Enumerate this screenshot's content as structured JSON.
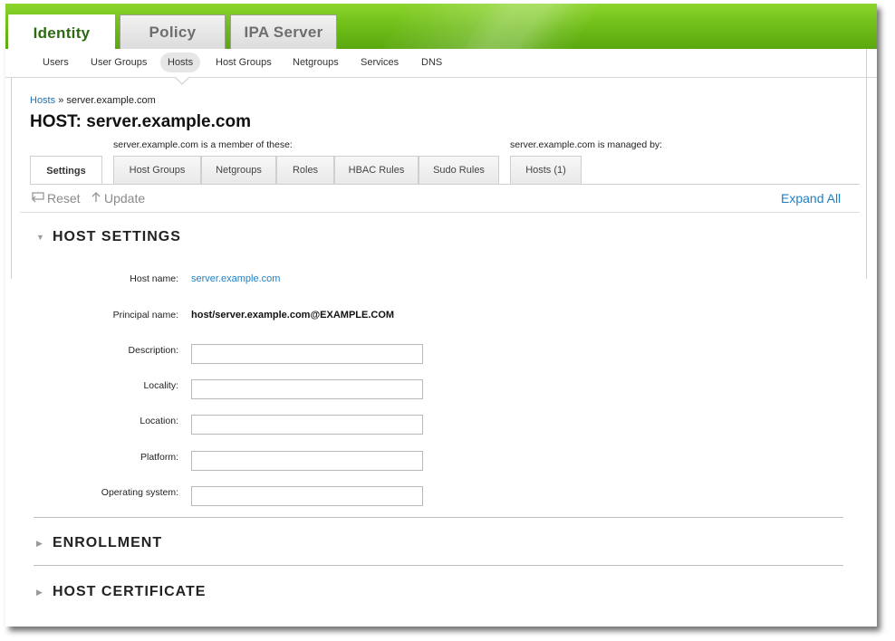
{
  "main_tabs": [
    {
      "label": "Identity",
      "active": true
    },
    {
      "label": "Policy",
      "active": false
    },
    {
      "label": "IPA Server",
      "active": false
    }
  ],
  "sub_nav": [
    {
      "label": "Users",
      "active": false
    },
    {
      "label": "User Groups",
      "active": false
    },
    {
      "label": "Hosts",
      "active": true
    },
    {
      "label": "Host Groups",
      "active": false
    },
    {
      "label": "Netgroups",
      "active": false
    },
    {
      "label": "Services",
      "active": false
    },
    {
      "label": "DNS",
      "active": false
    }
  ],
  "breadcrumb": {
    "link": "Hosts",
    "separator": "»",
    "current": "server.example.com"
  },
  "page_title": "HOST: server.example.com",
  "facets": {
    "member_caption": "server.example.com is a member of these:",
    "managed_caption": "server.example.com is managed by:",
    "tabs": [
      {
        "label": "Settings",
        "active": true
      },
      {
        "label": "Host Groups",
        "active": false
      },
      {
        "label": "Netgroups",
        "active": false
      },
      {
        "label": "Roles",
        "active": false
      },
      {
        "label": "HBAC Rules",
        "active": false
      },
      {
        "label": "Sudo Rules",
        "active": false
      },
      {
        "label": "Hosts (1)",
        "active": false
      }
    ]
  },
  "actions": {
    "reset": "Reset",
    "update": "Update",
    "expand_all": "Expand All"
  },
  "sections": {
    "host_settings": "HOST SETTINGS",
    "enrollment": "ENROLLMENT",
    "host_certificate": "HOST CERTIFICATE"
  },
  "fields": {
    "host_name": {
      "label": "Host name:",
      "value": "server.example.com"
    },
    "principal_name": {
      "label": "Principal name:",
      "value": "host/server.example.com@EXAMPLE.COM"
    },
    "description": {
      "label": "Description:",
      "value": ""
    },
    "locality": {
      "label": "Locality:",
      "value": ""
    },
    "location": {
      "label": "Location:",
      "value": ""
    },
    "platform": {
      "label": "Platform:",
      "value": ""
    },
    "operating_system": {
      "label": "Operating system:",
      "value": ""
    }
  },
  "icons": {
    "reset": "reset-icon",
    "update": "update-icon",
    "expanded": "triangle-down-icon",
    "collapsed": "triangle-right-icon"
  },
  "colors": {
    "header_green": "#6dbb17",
    "active_tab_text": "#2d6b10",
    "link_blue": "#1f7fc4"
  }
}
